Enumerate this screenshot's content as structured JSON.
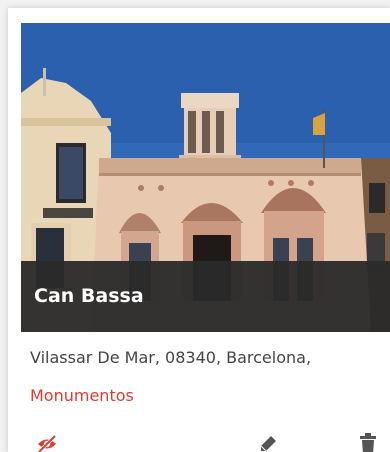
{
  "place": {
    "title": "Can Bassa",
    "address": "Vilassar De Mar, 08340, Barcelona,",
    "category": "Monumentos"
  },
  "actions": [
    {
      "name": "hide",
      "icon": "eye-slash-icon",
      "color": "#e03b2f"
    },
    {
      "name": "edit",
      "icon": "pencil-icon",
      "color": "#555555"
    },
    {
      "name": "delete",
      "icon": "trash-icon",
      "color": "#555555"
    }
  ],
  "colors": {
    "accent": "#e03b2f",
    "title_bar": "#2a2a2a",
    "sky": "#2f69b8"
  }
}
